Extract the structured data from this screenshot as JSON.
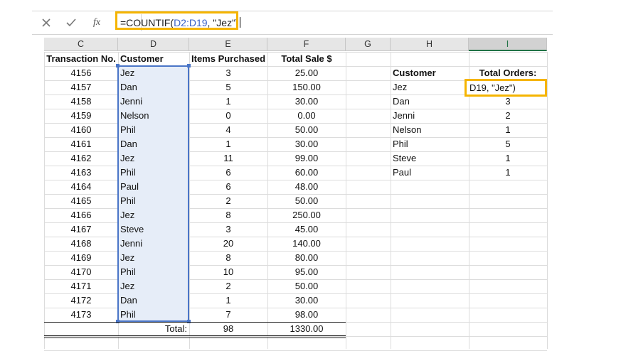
{
  "formula_bar": {
    "cancel_icon": "x-icon",
    "enter_icon": "check-icon",
    "function_icon": "fx-icon",
    "function_label": "fx",
    "formula_prefix": "=COUNTIF(",
    "formula_ref": "D2:D19",
    "formula_suffix": ", \"Jez\")"
  },
  "columns": [
    {
      "id": "C",
      "label": "C"
    },
    {
      "id": "D",
      "label": "D"
    },
    {
      "id": "E",
      "label": "E"
    },
    {
      "id": "F",
      "label": "F"
    },
    {
      "id": "G",
      "label": "G"
    },
    {
      "id": "H",
      "label": "H"
    },
    {
      "id": "I",
      "label": "I"
    }
  ],
  "table": {
    "headers": [
      "Transaction No.",
      "Customer",
      "Items Purchased",
      "Total Sale $"
    ],
    "rows": [
      [
        "4156",
        "Jez",
        "3",
        "25.00"
      ],
      [
        "4157",
        "Dan",
        "5",
        "150.00"
      ],
      [
        "4158",
        "Jenni",
        "1",
        "30.00"
      ],
      [
        "4159",
        "Nelson",
        "0",
        "0.00"
      ],
      [
        "4160",
        "Phil",
        "4",
        "50.00"
      ],
      [
        "4161",
        "Dan",
        "1",
        "30.00"
      ],
      [
        "4162",
        "Jez",
        "11",
        "99.00"
      ],
      [
        "4163",
        "Phil",
        "6",
        "60.00"
      ],
      [
        "4164",
        "Paul",
        "6",
        "48.00"
      ],
      [
        "4165",
        "Phil",
        "2",
        "50.00"
      ],
      [
        "4166",
        "Jez",
        "8",
        "250.00"
      ],
      [
        "4167",
        "Steve",
        "3",
        "45.00"
      ],
      [
        "4168",
        "Jenni",
        "20",
        "140.00"
      ],
      [
        "4169",
        "Jez",
        "8",
        "80.00"
      ],
      [
        "4170",
        "Phil",
        "10",
        "95.00"
      ],
      [
        "4171",
        "Jez",
        "2",
        "50.00"
      ],
      [
        "4172",
        "Dan",
        "1",
        "30.00"
      ],
      [
        "4173",
        "Phil",
        "7",
        "98.00"
      ]
    ],
    "total_label": "Total:",
    "total_items": "98",
    "total_sale": "1330.00"
  },
  "summary": {
    "header_customer": "Customer",
    "header_orders": "Total Orders:",
    "editing_text": "D19, \"Jez\")",
    "rows": [
      {
        "customer": "Jez",
        "orders": ""
      },
      {
        "customer": "Dan",
        "orders": "3"
      },
      {
        "customer": "Jenni",
        "orders": "2"
      },
      {
        "customer": "Nelson",
        "orders": "1"
      },
      {
        "customer": "Phil",
        "orders": "5"
      },
      {
        "customer": "Steve",
        "orders": "1"
      },
      {
        "customer": "Paul",
        "orders": "1"
      }
    ]
  },
  "colors": {
    "highlight": "#f5b400",
    "range": "#4a75c7",
    "range_fill": "#e6edf8",
    "selected_header": "#217346"
  }
}
